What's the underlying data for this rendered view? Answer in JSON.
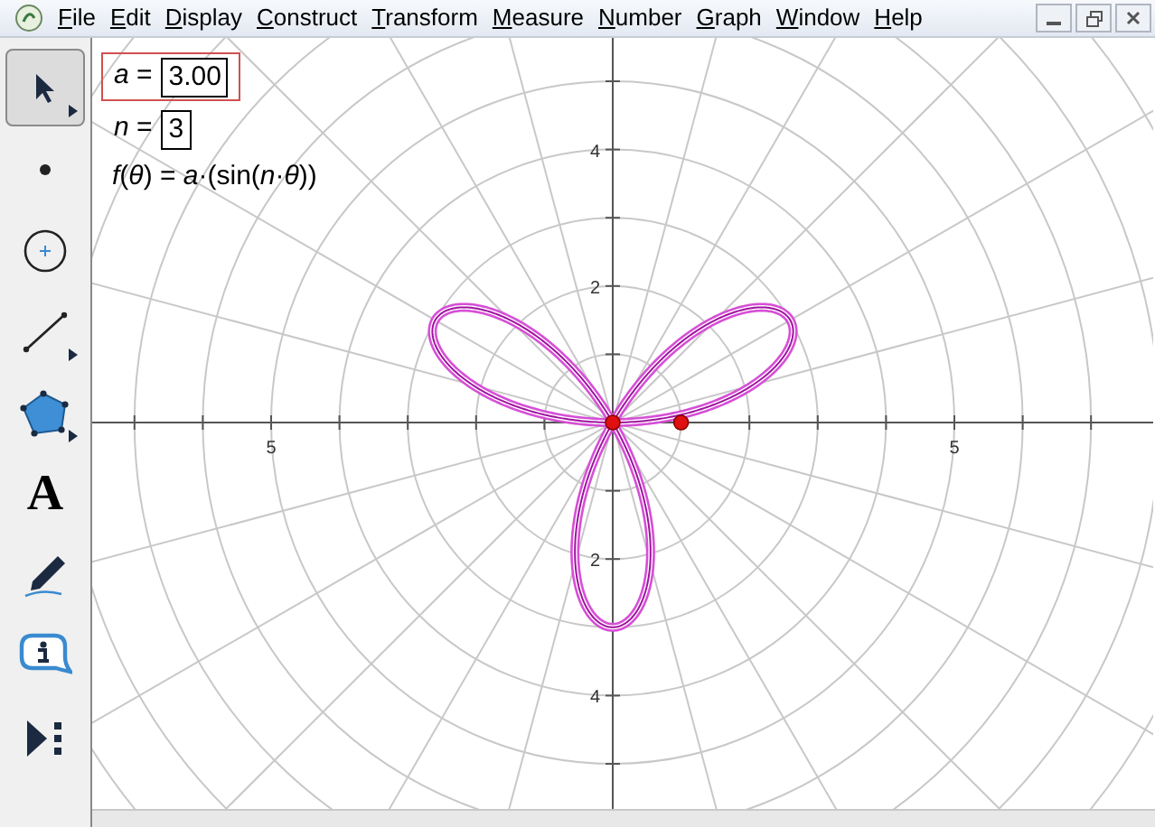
{
  "menu": [
    "File",
    "Edit",
    "Display",
    "Construct",
    "Transform",
    "Measure",
    "Number",
    "Graph",
    "Window",
    "Help"
  ],
  "tools": [
    {
      "kind": "arrow",
      "selected": true,
      "submenu": true
    },
    {
      "kind": "point",
      "selected": false,
      "submenu": false
    },
    {
      "kind": "compass",
      "selected": false,
      "submenu": false
    },
    {
      "kind": "straightedge",
      "selected": false,
      "submenu": true
    },
    {
      "kind": "polygon",
      "selected": false,
      "submenu": true
    },
    {
      "kind": "text",
      "label": "A",
      "selected": false,
      "submenu": false
    },
    {
      "kind": "marker",
      "selected": false,
      "submenu": false
    },
    {
      "kind": "info",
      "selected": false,
      "submenu": false
    },
    {
      "kind": "custom",
      "selected": false,
      "submenu": false
    }
  ],
  "parameters": [
    {
      "label": "*a* =",
      "value": "3.00",
      "selected": true
    },
    {
      "label": "*n* =",
      "value": "3",
      "selected": false
    }
  ],
  "function": "*f*(*θ*) = *a*·(sin(*n*·*θ*))",
  "y_axis_labels": [
    "4",
    "2",
    "2",
    "4"
  ],
  "x_axis_labels": [
    "5",
    "5"
  ]
}
